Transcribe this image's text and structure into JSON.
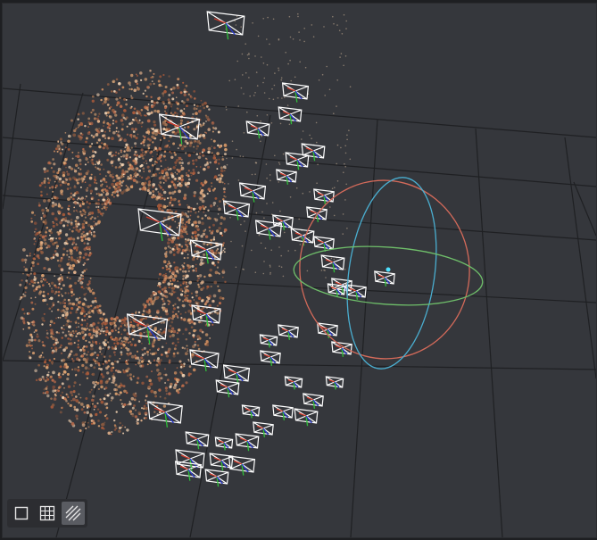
{
  "viewport": {
    "background_color": "#35373c",
    "grid_color": "#1f2023",
    "camera_frustum_color": "#ffffff",
    "gizmo_colors": {
      "x": "#d46a5a",
      "y": "#6fbf6a",
      "z": "#4aaed0"
    },
    "point_cloud_palette": [
      "#c98a5e",
      "#e0b08a",
      "#a85a3a",
      "#f0d0b0",
      "#8a5a40",
      "#d9a070",
      "#b86a4a"
    ]
  },
  "toolbar": {
    "buttons": [
      {
        "name": "solid-view-button",
        "icon": "square-icon",
        "active": false
      },
      {
        "name": "grid-view-button",
        "icon": "grid-icon",
        "active": false
      },
      {
        "name": "wireframe-view-button",
        "icon": "hatch-icon",
        "active": true
      }
    ]
  }
}
